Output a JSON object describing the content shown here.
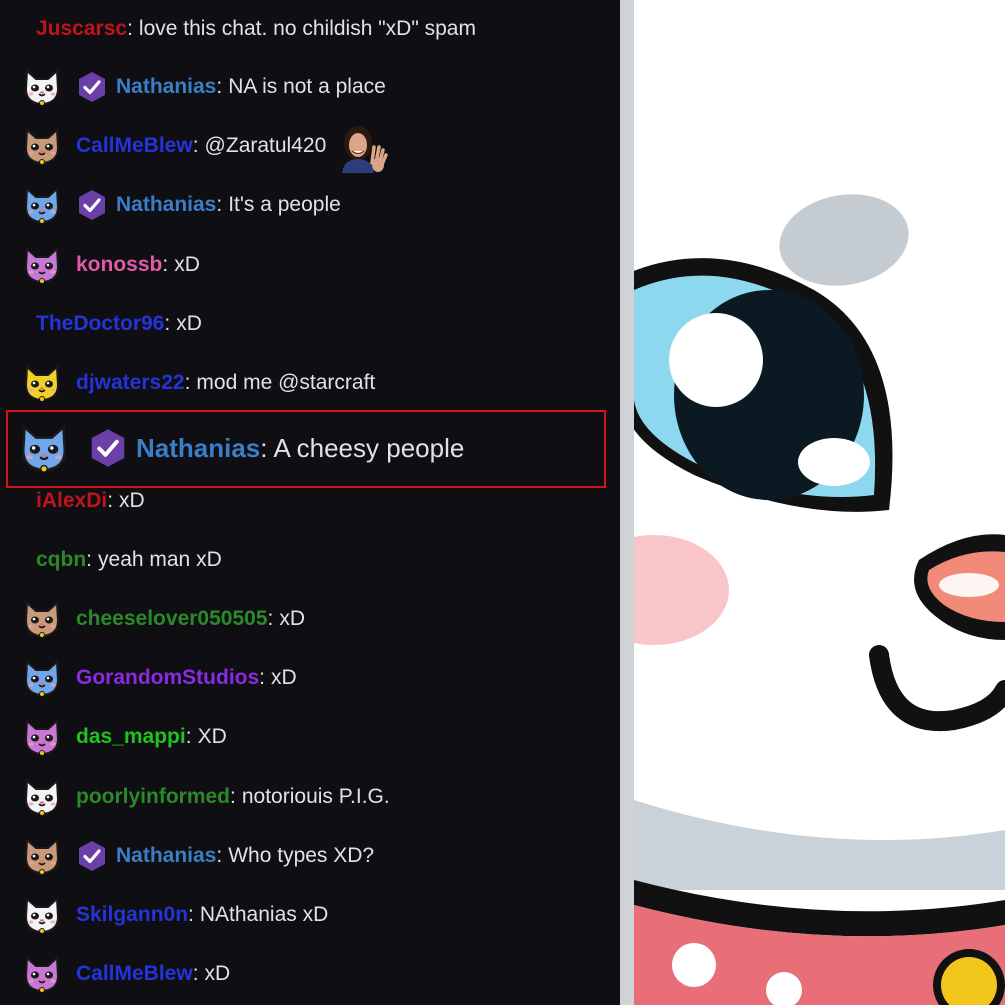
{
  "chat": {
    "messages": [
      {
        "id": "m1",
        "user": "Juscarsc",
        "user_color": "#c0141b",
        "avatar": null,
        "badge": false,
        "text": "love this chat. no childish \"xD\" spam"
      },
      {
        "id": "m2",
        "user": "Nathanias",
        "user_color": "#3a7ec8",
        "avatar": "white-cat",
        "badge": true,
        "text": "NA is not a place"
      },
      {
        "id": "m3",
        "user": "CallMeBlew",
        "user_color": "#2434d8",
        "avatar": "tan-cat",
        "badge": false,
        "text": "@Zaratul420",
        "emote": "waving-woman-emote"
      },
      {
        "id": "m4",
        "user": "Nathanias",
        "user_color": "#3a7ec8",
        "avatar": "blue-cat",
        "badge": true,
        "text": "It's a people"
      },
      {
        "id": "m5",
        "user": "konossb",
        "user_color": "#e05aa8",
        "avatar": "pink-cat",
        "badge": false,
        "text": "xD"
      },
      {
        "id": "m6",
        "user": "TheDoctor96",
        "user_color": "#2434d8",
        "avatar": null,
        "badge": false,
        "text": "xD"
      },
      {
        "id": "m7",
        "user": "djwaters22",
        "user_color": "#2434d8",
        "avatar": "yellow-cat",
        "badge": false,
        "text": "mod me @starcraft"
      },
      {
        "id": "m8",
        "user": "Nathanias",
        "user_color": "#3a7ec8",
        "avatar": "blue-cat",
        "badge": true,
        "text": "A cheesy people",
        "highlighted": true
      },
      {
        "id": "m9",
        "user": "iAlexDi",
        "user_color": "#c0141b",
        "avatar": null,
        "badge": false,
        "text": "xD"
      },
      {
        "id": "m10",
        "user": "cqbn",
        "user_color": "#2a8a2a",
        "avatar": null,
        "badge": false,
        "text": "yeah man xD"
      },
      {
        "id": "m11",
        "user": "cheeselover050505",
        "user_color": "#2a8a2a",
        "avatar": "tan-cat",
        "badge": false,
        "text": "xD"
      },
      {
        "id": "m12",
        "user": "GorandomStudios",
        "user_color": "#8a2be2",
        "avatar": "blue-cat",
        "badge": false,
        "text": "xD"
      },
      {
        "id": "m13",
        "user": "das_mappi",
        "user_color": "#1fc21f",
        "avatar": "pink-cat",
        "badge": false,
        "text": "XD"
      },
      {
        "id": "m14",
        "user": "poorlyinformed",
        "user_color": "#2a8a2a",
        "avatar": "white-cat",
        "badge": false,
        "text": "notoriouis P.I.G."
      },
      {
        "id": "m15",
        "user": "Nathanias",
        "user_color": "#3a7ec8",
        "avatar": "tan-cat",
        "badge": true,
        "text": "Who types XD?"
      },
      {
        "id": "m16",
        "user": "Skilgann0n",
        "user_color": "#2434d8",
        "avatar": "white-cat",
        "badge": false,
        "text": "NAthanias xD"
      },
      {
        "id": "m17",
        "user": "CallMeBlew",
        "user_color": "#2434d8",
        "avatar": "pink-cat",
        "badge": false,
        "text": "xD"
      }
    ]
  },
  "colors": {
    "chat_background": "#0f0e12",
    "highlight_border": "#d1141b",
    "badge_purple": "#6a3fa8",
    "cat_white": "#f4f4f6",
    "cat_tan": "#c99a7a",
    "cat_blue": "#6fa7ea",
    "cat_pink": "#c777d6",
    "cat_yellow": "#f2d02a"
  },
  "emote_art": {
    "name": "giant-white-cat-emote"
  }
}
